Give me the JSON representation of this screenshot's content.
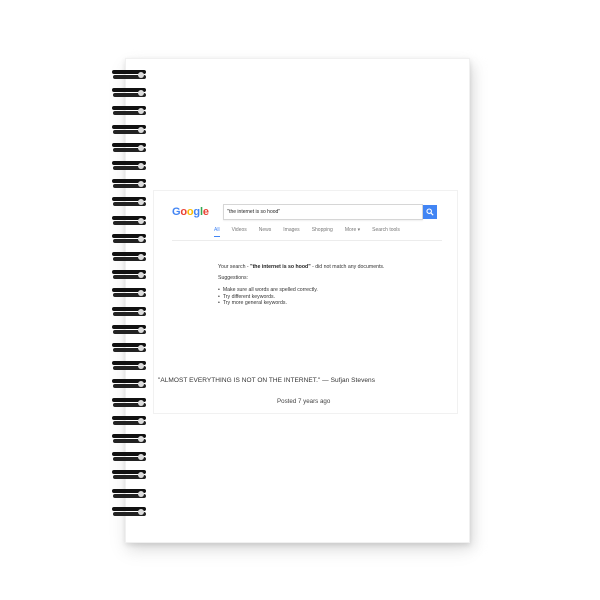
{
  "google": {
    "logo_letters": [
      {
        "char": "G",
        "color": "#4285f4"
      },
      {
        "char": "o",
        "color": "#ea4335"
      },
      {
        "char": "o",
        "color": "#fbbc05"
      },
      {
        "char": "g",
        "color": "#4285f4"
      },
      {
        "char": "l",
        "color": "#34a853"
      },
      {
        "char": "e",
        "color": "#ea4335"
      }
    ],
    "search_value": "\"the internet is so hood\"",
    "search_icon": "search-icon",
    "tabs": [
      "All",
      "Videos",
      "News",
      "Images",
      "Shopping",
      "More ▾",
      "Search tools"
    ],
    "active_tab": "All",
    "result": {
      "prefix": "Your search - ",
      "query": "\"the internet is so hood\"",
      "suffix": " - did not match any documents."
    },
    "suggestions_title": "Suggestions:",
    "suggestions": [
      "Make sure all words are spelled correctly.",
      "Try different keywords.",
      "Try more general keywords."
    ]
  },
  "quote": "\"ALMOST EVERYTHING IS NOT ON THE INTERNET.\" — Sufjan Stevens",
  "posted": "Posted 7 years ago",
  "colors": {
    "accent_blue": "#4285f4",
    "spiral": "#111111"
  }
}
